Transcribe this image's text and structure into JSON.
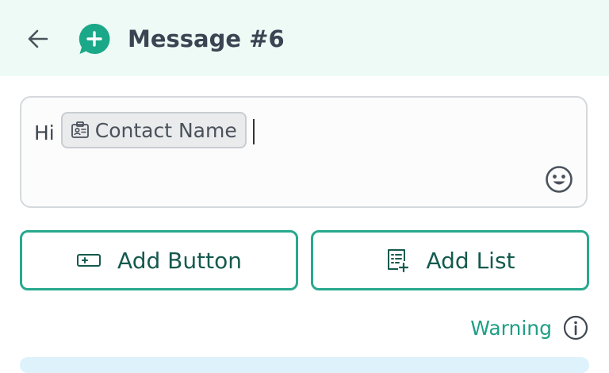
{
  "header": {
    "title": "Message #6",
    "back_icon": "arrow-left-icon",
    "app_icon": "chat-plus-icon",
    "background": "#edfaf5",
    "accent": "#1aa888"
  },
  "editor": {
    "text_before": "Hi",
    "variable_chip": {
      "icon": "contact-card-icon",
      "label": "Contact Name"
    },
    "emoji_icon": "smiley-face-icon"
  },
  "actions": {
    "add_button_label": "Add Button",
    "add_button_icon": "button-plus-icon",
    "add_list_label": "Add List",
    "add_list_icon": "list-plus-icon",
    "border_color": "#27a98e"
  },
  "warning": {
    "label": "Warning",
    "icon": "info-circle-icon",
    "color": "#1f9f86"
  }
}
